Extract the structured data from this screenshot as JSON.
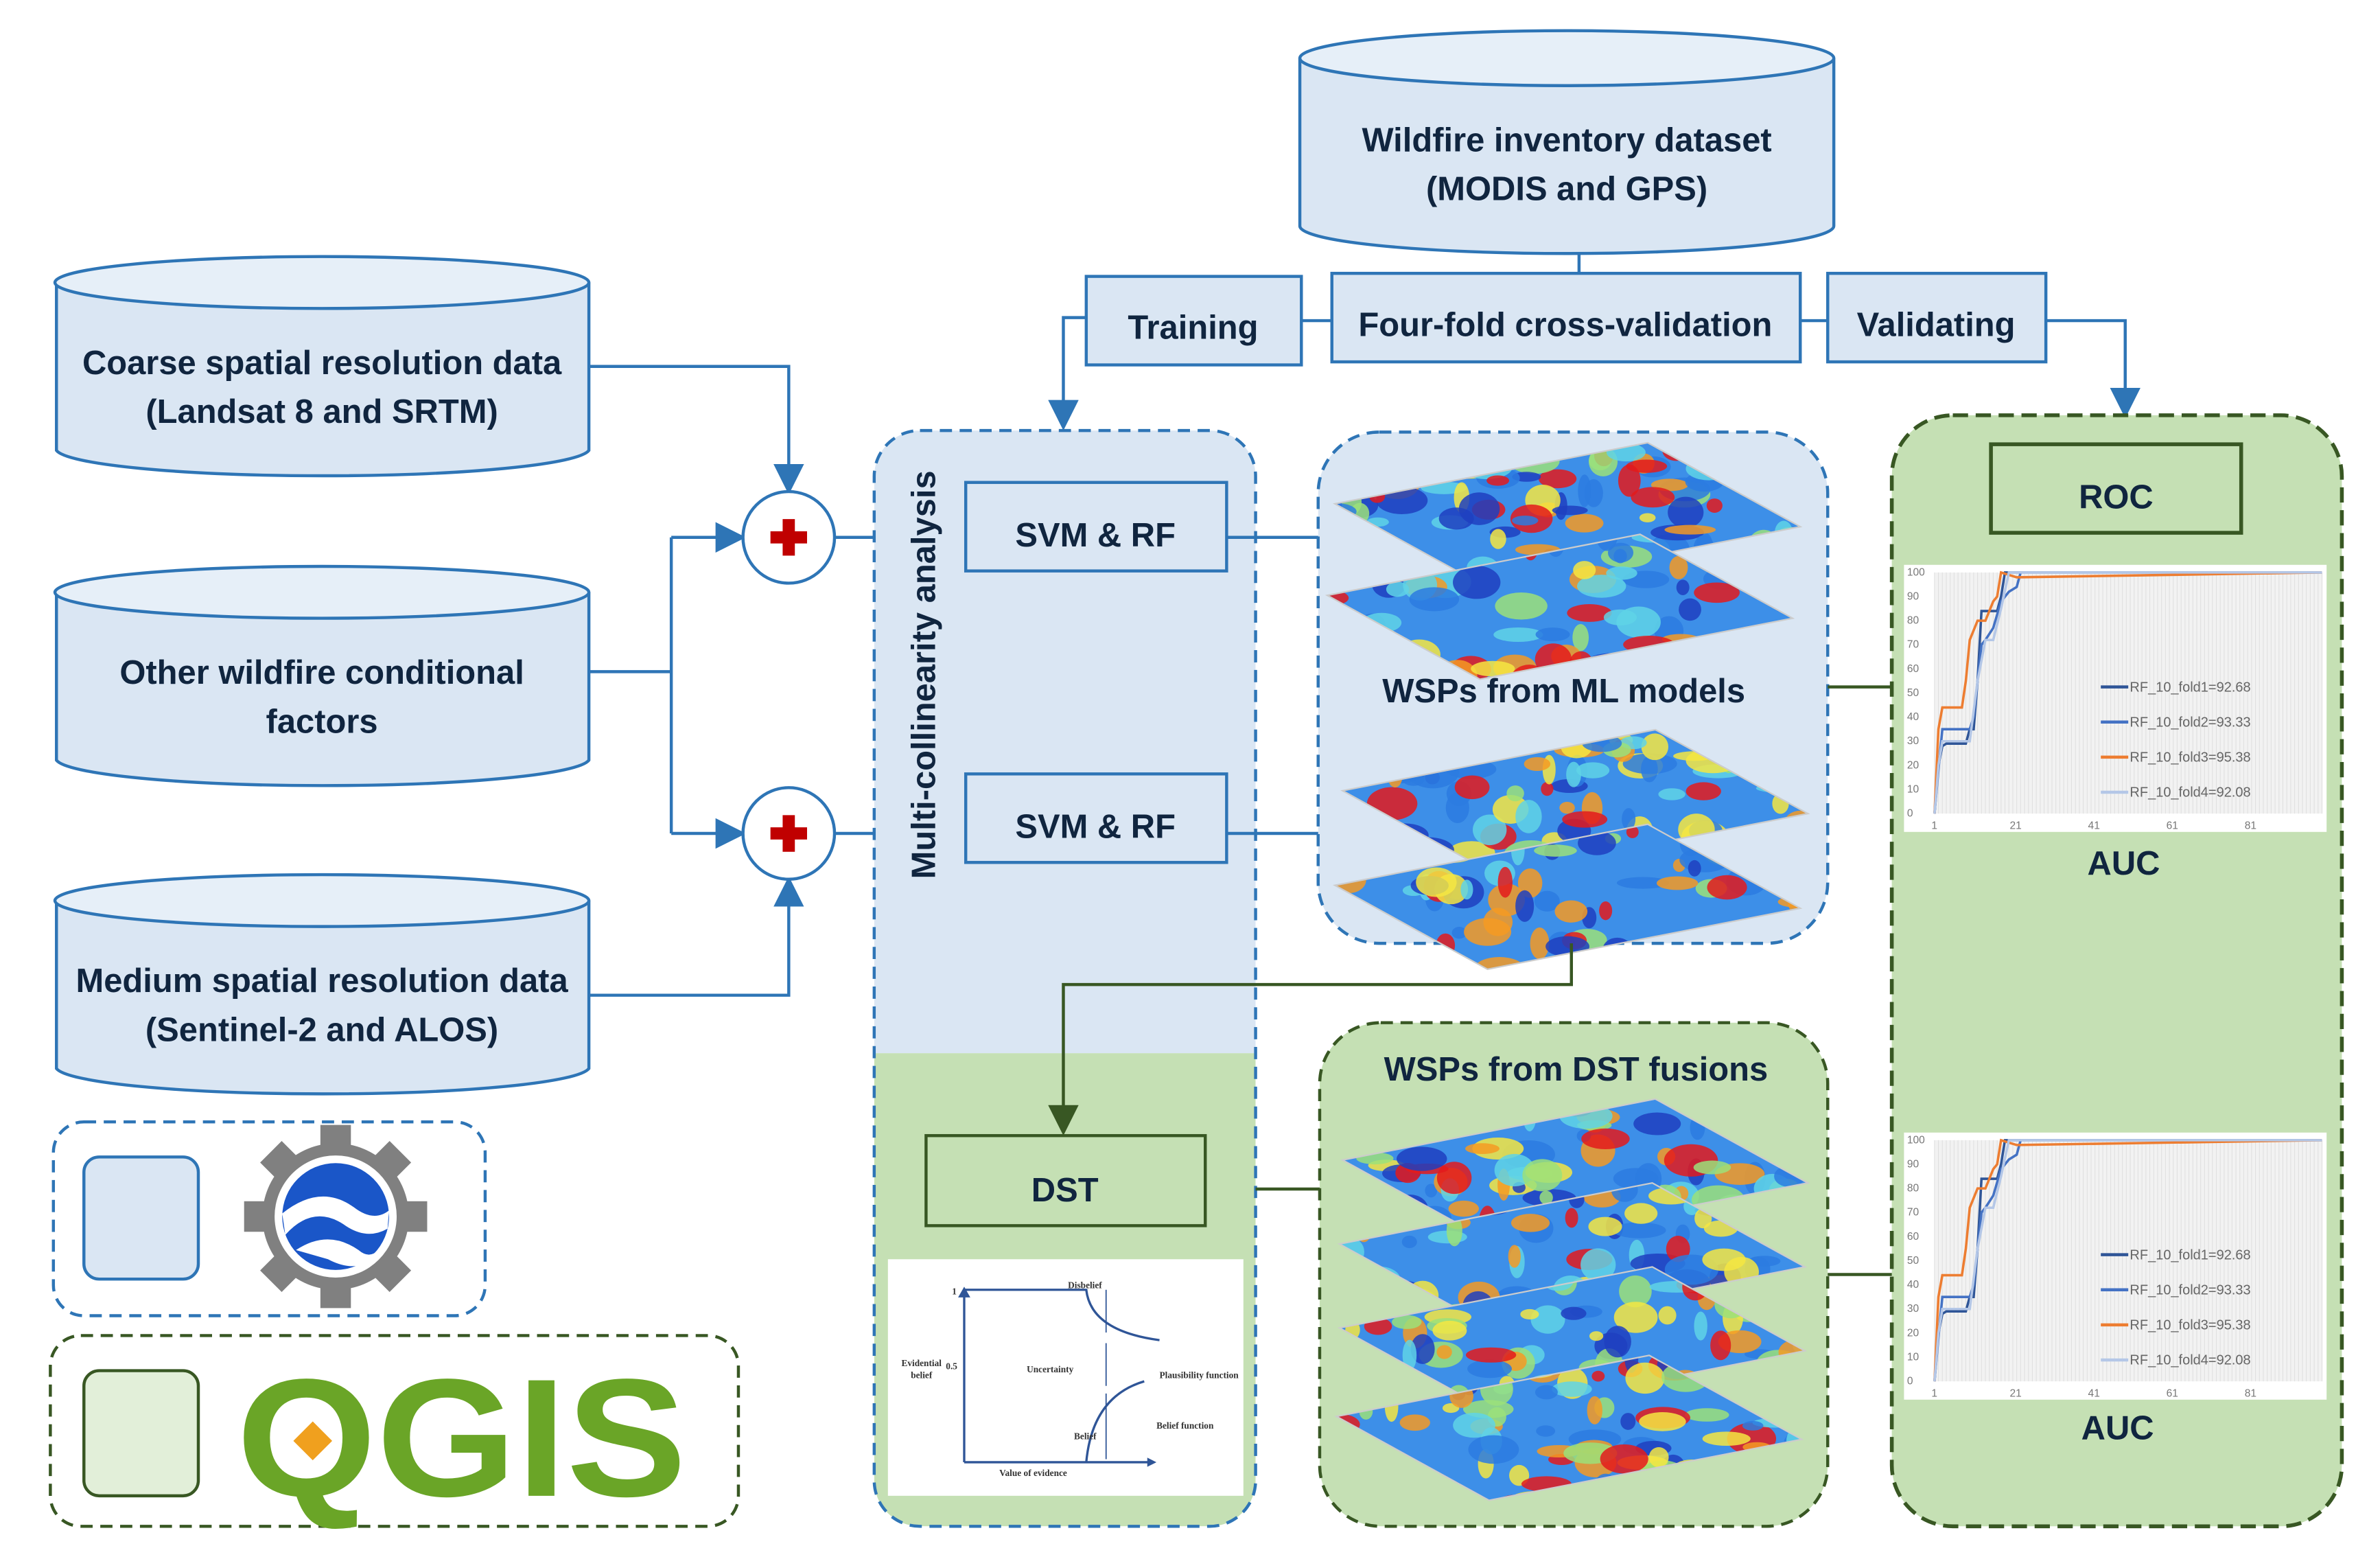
{
  "colors": {
    "blue": "#2e75b6",
    "light_blue": "#dae6f3",
    "green_fill": "#c5e0b4",
    "dark_green": "#385723",
    "plus_red": "#c00000"
  },
  "inventory": {
    "line1": "Wildfire inventory dataset",
    "line2": "(MODIS and GPS)"
  },
  "split": {
    "training": "Training",
    "cv": "Four-fold cross-validation",
    "validating": "Validating"
  },
  "inputs": [
    {
      "line1": "Coarse spatial resolution data",
      "line2": "(Landsat 8 and SRTM)"
    },
    {
      "line1": "Other wildfire conditional",
      "line2": "factors"
    },
    {
      "line1": "Medium spatial resolution data",
      "line2": "(Sentinel-2 and ALOS)"
    }
  ],
  "icons": {
    "plus": "plus-icon",
    "gear": "google-earth-engine-gear-icon",
    "qgis": "qgis-logo"
  },
  "multi": {
    "label": "Multi-collinearity analysis",
    "model1": "SVM & RF",
    "model2": "SVM & RF",
    "dst": "DST"
  },
  "dst_chart": {
    "y_top": "1",
    "y_mid": "0.5",
    "ylabel1": "Evidential",
    "ylabel2": "belief",
    "xlabel": "Value of evidence",
    "disbelief": "Disbelief",
    "uncertainty": "Uncertainty",
    "belief": "Belief",
    "plausibility": "Plausibility function",
    "belief_fn": "Belief function"
  },
  "ml": {
    "title": "WSPs from ML models"
  },
  "fusion": {
    "title": "WSPs from DST fusions"
  },
  "validation": {
    "roc": "ROC",
    "auc1": "AUC",
    "auc2": "AUC"
  },
  "legend": {
    "qgis_text": "QGIS"
  },
  "chart_data": [
    {
      "type": "line",
      "title": "",
      "xlabel": "",
      "ylabel": "",
      "xlim": [
        1,
        100
      ],
      "ylim": [
        0,
        100
      ],
      "xticks": [
        "1",
        "21",
        "41",
        "61",
        "81"
      ],
      "yticks": [
        "0",
        "10",
        "20",
        "30",
        "40",
        "50",
        "60",
        "70",
        "80",
        "90",
        "100"
      ],
      "grid": true,
      "legend": "right",
      "series": [
        {
          "name": "RF_10_fold1=92.68",
          "color": "#2f5597",
          "x": [
            1,
            2,
            3,
            4,
            9,
            10,
            11,
            12,
            13,
            17,
            18,
            19,
            23
          ],
          "y": [
            0,
            20,
            28,
            29,
            29,
            35,
            35,
            55,
            84,
            84,
            90,
            100,
            100
          ]
        },
        {
          "name": "RF_10_fold2=93.33",
          "color": "#4472c4",
          "x": [
            1,
            2,
            3,
            10,
            11,
            13,
            14,
            16,
            18,
            20,
            22,
            23,
            100
          ],
          "y": [
            0,
            18,
            35,
            35,
            40,
            70,
            72,
            77,
            88,
            92,
            94,
            100,
            100
          ]
        },
        {
          "name": "RF_10_fold3=95.38",
          "color": "#ed7d31",
          "x": [
            1,
            2,
            3,
            8,
            9,
            10,
            12,
            14,
            16,
            17,
            18,
            22,
            100
          ],
          "y": [
            0,
            35,
            44,
            44,
            55,
            72,
            80,
            80,
            88,
            90,
            100,
            98,
            100
          ]
        },
        {
          "name": "RF_10_fold4=92.08",
          "color": "#b4c7e7",
          "x": [
            1,
            2,
            3,
            10,
            12,
            14,
            16,
            18,
            20,
            100
          ],
          "y": [
            0,
            20,
            30,
            30,
            55,
            72,
            72,
            85,
            100,
            100
          ]
        }
      ]
    },
    {
      "type": "line",
      "title": "",
      "xlabel": "",
      "ylabel": "",
      "xlim": [
        1,
        100
      ],
      "ylim": [
        0,
        100
      ],
      "xticks": [
        "1",
        "21",
        "41",
        "61",
        "81"
      ],
      "yticks": [
        "0",
        "10",
        "20",
        "30",
        "40",
        "50",
        "60",
        "70",
        "80",
        "90",
        "100"
      ],
      "grid": true,
      "legend": "right",
      "series": [
        {
          "name": "RF_10_fold1=92.68",
          "color": "#2f5597",
          "x": [
            1,
            2,
            3,
            4,
            9,
            10,
            11,
            12,
            13,
            17,
            18,
            19,
            23
          ],
          "y": [
            0,
            20,
            28,
            29,
            29,
            35,
            35,
            55,
            84,
            84,
            90,
            100,
            100
          ]
        },
        {
          "name": "RF_10_fold2=93.33",
          "color": "#4472c4",
          "x": [
            1,
            2,
            3,
            10,
            11,
            13,
            14,
            16,
            18,
            20,
            22,
            23,
            100
          ],
          "y": [
            0,
            18,
            35,
            35,
            40,
            70,
            72,
            77,
            88,
            92,
            94,
            100,
            100
          ]
        },
        {
          "name": "RF_10_fold3=95.38",
          "color": "#ed7d31",
          "x": [
            1,
            2,
            3,
            8,
            9,
            10,
            12,
            14,
            16,
            17,
            18,
            22,
            100
          ],
          "y": [
            0,
            35,
            44,
            44,
            55,
            72,
            80,
            80,
            88,
            90,
            100,
            98,
            100
          ]
        },
        {
          "name": "RF_10_fold4=92.08",
          "color": "#b4c7e7",
          "x": [
            1,
            2,
            3,
            10,
            12,
            14,
            16,
            18,
            20,
            100
          ],
          "y": [
            0,
            20,
            30,
            30,
            55,
            72,
            72,
            85,
            100,
            100
          ]
        }
      ]
    }
  ]
}
